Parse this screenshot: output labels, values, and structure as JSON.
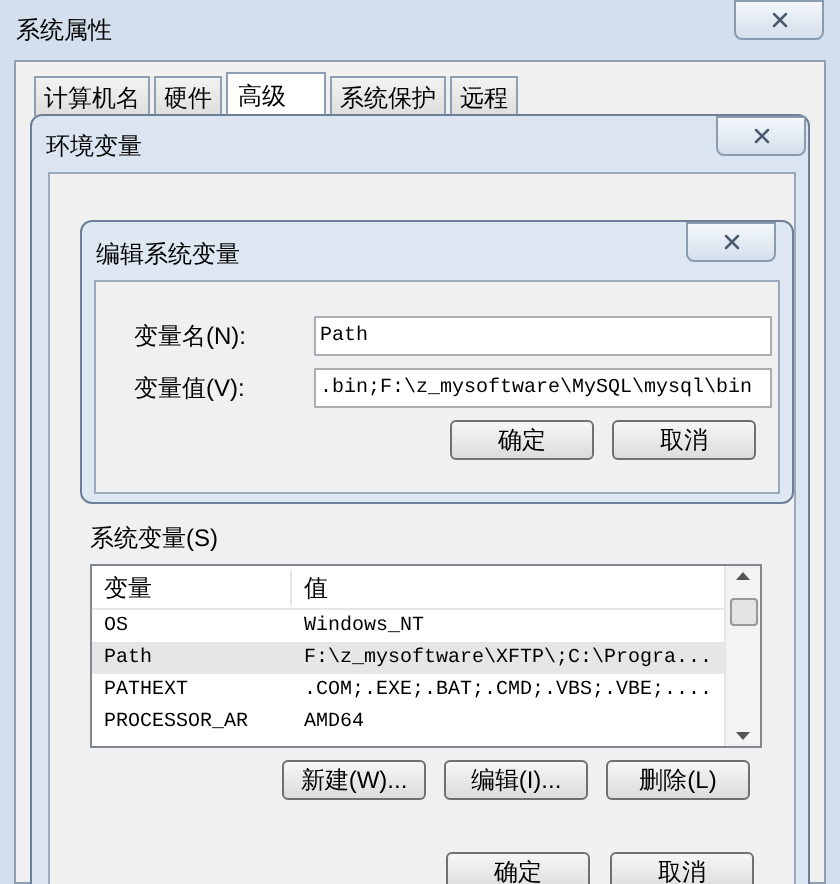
{
  "system_properties": {
    "title": "系统属性",
    "tabs": [
      {
        "label": "计算机名",
        "selected": false
      },
      {
        "label": "硬件",
        "selected": false
      },
      {
        "label": "高级",
        "selected": true
      },
      {
        "label": "系统保护",
        "selected": false
      },
      {
        "label": "远程",
        "selected": false
      }
    ]
  },
  "environment_variables": {
    "title": "环境变量",
    "system_variables": {
      "label": "系统变量(S)",
      "columns": [
        "变量",
        "值"
      ],
      "rows": [
        {
          "name": "OS",
          "value": "Windows_NT",
          "selected": false
        },
        {
          "name": "Path",
          "value": "F:\\z_mysoftware\\XFTP\\;C:\\Progra...",
          "selected": true
        },
        {
          "name": "PATHEXT",
          "value": ".COM;.EXE;.BAT;.CMD;.VBS;.VBE;....",
          "selected": false
        },
        {
          "name": "PROCESSOR_AR",
          "value": "AMD64",
          "selected": false
        }
      ],
      "buttons": [
        "新建(W)...",
        "编辑(I)...",
        "删除(L)"
      ]
    },
    "footer_buttons": [
      "确定",
      "取消"
    ]
  },
  "edit_dialog": {
    "title": "编辑系统变量",
    "fields": [
      {
        "label": "变量名(N):",
        "value": "Path"
      },
      {
        "label": "变量值(V):",
        "value": ".bin;F:\\z_mysoftware\\MySQL\\mysql\\bin"
      }
    ],
    "buttons": [
      "确定",
      "取消"
    ]
  }
}
